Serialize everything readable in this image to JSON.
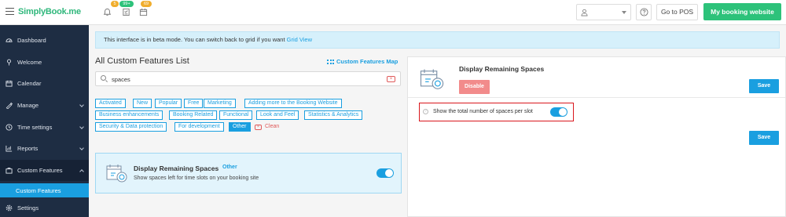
{
  "header": {
    "logo": "SimplyBook.me",
    "badges": [
      "5",
      "99+",
      "69"
    ],
    "go_to_pos": "Go to POS",
    "my_booking_website": "My booking website"
  },
  "sidebar": {
    "items": [
      {
        "label": "Dashboard",
        "icon": "dashboard-icon"
      },
      {
        "label": "Welcome",
        "icon": "welcome-icon"
      },
      {
        "label": "Calendar",
        "icon": "calendar-icon"
      },
      {
        "label": "Manage",
        "icon": "manage-icon"
      },
      {
        "label": "Time settings",
        "icon": "clock-icon"
      },
      {
        "label": "Reports",
        "icon": "reports-icon"
      },
      {
        "label": "Custom Features",
        "icon": "custom-features-icon"
      },
      {
        "label": "Settings",
        "icon": "gear-icon"
      }
    ],
    "sub_item": "Custom Features"
  },
  "beta_notice": {
    "text": "This interface is in beta mode. You can switch back to grid if you want ",
    "link": "Grid View"
  },
  "features_list": {
    "title": "All Custom Features List",
    "map_link": "Custom Features Map",
    "search_value": "spaces",
    "tags": [
      "Activated",
      "New",
      "Popular",
      "Free",
      "Marketing",
      "Adding more to the Booking Website",
      "Business enhancements",
      "Booking Related",
      "Functional",
      "Look and Feel",
      "Statistics & Analytics",
      "Security & Data protection",
      "For development",
      "Other"
    ],
    "active_tag": "Other",
    "clean_label": "Clean",
    "card": {
      "name": "Display Remaining Spaces",
      "category": "Other",
      "description": "Show spaces left for time slots on your booking site",
      "enabled": true
    }
  },
  "detail_panel": {
    "title": "Display Remaining Spaces",
    "disable_label": "Disable",
    "save_label": "Save",
    "setting_label": "Show the total number of spaces per slot",
    "setting_enabled": true
  },
  "colors": {
    "accent": "#1a9fe0",
    "brand_green": "#2dc27a",
    "sidebar_bg": "#1e2d43",
    "danger": "#d9161c"
  }
}
